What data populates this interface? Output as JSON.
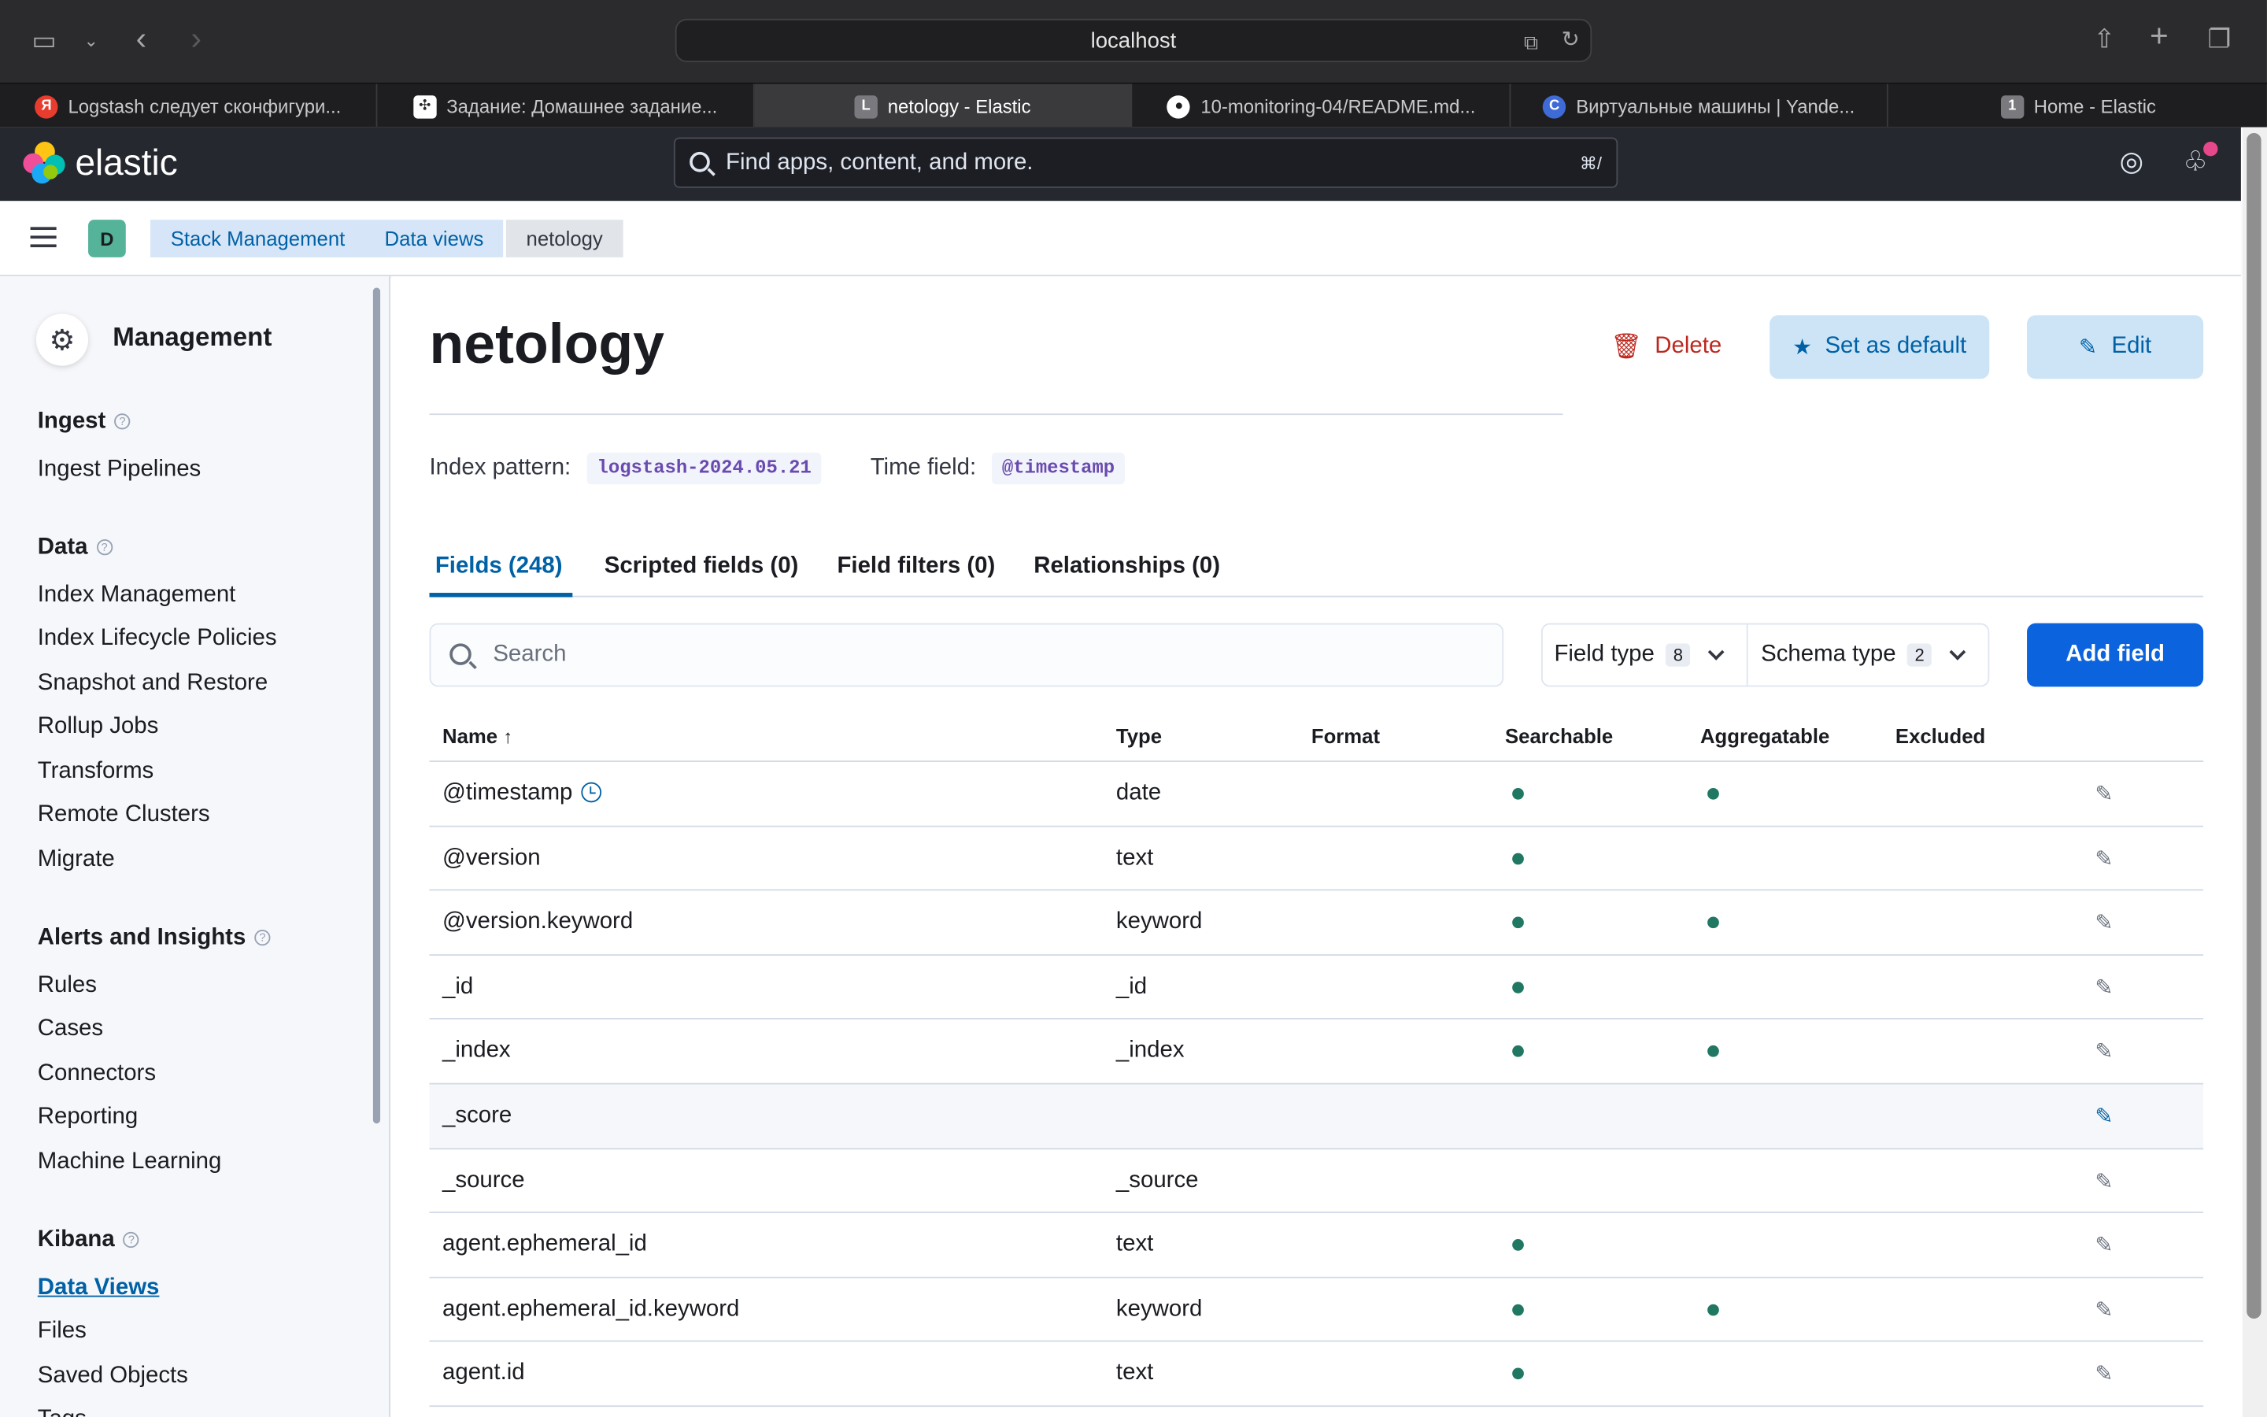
{
  "browser": {
    "url": "localhost",
    "tabs": [
      {
        "label": "Logstash следует сконфигури...",
        "fav": "Я",
        "fav_color": "#e83d2e"
      },
      {
        "label": "Задание: Домашнее задание...",
        "fav": "✣",
        "fav_color": "#2b2b2d"
      },
      {
        "label": "netology - Elastic",
        "fav": "L",
        "fav_color": "#7a7a7e"
      },
      {
        "label": "10-monitoring-04/README.md...",
        "fav": "●",
        "fav_color": "#1e1e20"
      },
      {
        "label": "Виртуальные машины | Yande...",
        "fav": "C",
        "fav_color": "#3e6bd6"
      },
      {
        "label": "Home - Elastic",
        "fav": "1",
        "fav_color": "#7a7a7e"
      }
    ]
  },
  "header": {
    "brand": "elastic",
    "search_placeholder": "Find apps, content, and more.",
    "search_shortcut": "⌘/"
  },
  "breadcrumbs": {
    "space": "D",
    "items": [
      "Stack Management",
      "Data views",
      "netology"
    ]
  },
  "sidebar": {
    "title": "Management",
    "groups": [
      {
        "label": "Ingest",
        "items": [
          "Ingest Pipelines"
        ]
      },
      {
        "label": "Data",
        "items": [
          "Index Management",
          "Index Lifecycle Policies",
          "Snapshot and Restore",
          "Rollup Jobs",
          "Transforms",
          "Remote Clusters",
          "Migrate"
        ]
      },
      {
        "label": "Alerts and Insights",
        "items": [
          "Rules",
          "Cases",
          "Connectors",
          "Reporting",
          "Machine Learning"
        ]
      },
      {
        "label": "Kibana",
        "items": [
          "Data Views",
          "Files",
          "Saved Objects",
          "Tags"
        ]
      }
    ],
    "active_item": "Data Views"
  },
  "page": {
    "title": "netology",
    "delete_label": "Delete",
    "set_default_label": "Set as default",
    "edit_label": "Edit",
    "index_pattern_label": "Index pattern:",
    "index_pattern_value": "logstash-2024.05.21",
    "time_field_label": "Time field:",
    "time_field_value": "@timestamp",
    "tabs": [
      "Fields (248)",
      "Scripted fields (0)",
      "Field filters (0)",
      "Relationships (0)"
    ],
    "search_placeholder": "Search",
    "field_type_label": "Field type",
    "field_type_count": "8",
    "schema_type_label": "Schema type",
    "schema_type_count": "2",
    "add_field_label": "Add field"
  },
  "table": {
    "columns": [
      "Name",
      "Type",
      "Format",
      "Searchable",
      "Aggregatable",
      "Excluded"
    ],
    "rows": [
      {
        "name": "@timestamp",
        "type": "date",
        "searchable": true,
        "aggregatable": true,
        "clock": true
      },
      {
        "name": "@version",
        "type": "text",
        "searchable": true,
        "aggregatable": false
      },
      {
        "name": "@version.keyword",
        "type": "keyword",
        "searchable": true,
        "aggregatable": true
      },
      {
        "name": "_id",
        "type": "_id",
        "searchable": true,
        "aggregatable": false
      },
      {
        "name": "_index",
        "type": "_index",
        "searchable": true,
        "aggregatable": true
      },
      {
        "name": "_score",
        "type": "",
        "searchable": false,
        "aggregatable": false
      },
      {
        "name": "_source",
        "type": "_source",
        "searchable": false,
        "aggregatable": false
      },
      {
        "name": "agent.ephemeral_id",
        "type": "text",
        "searchable": true,
        "aggregatable": false
      },
      {
        "name": "agent.ephemeral_id.keyword",
        "type": "keyword",
        "searchable": true,
        "aggregatable": true
      },
      {
        "name": "agent.id",
        "type": "text",
        "searchable": true,
        "aggregatable": false
      }
    ]
  }
}
